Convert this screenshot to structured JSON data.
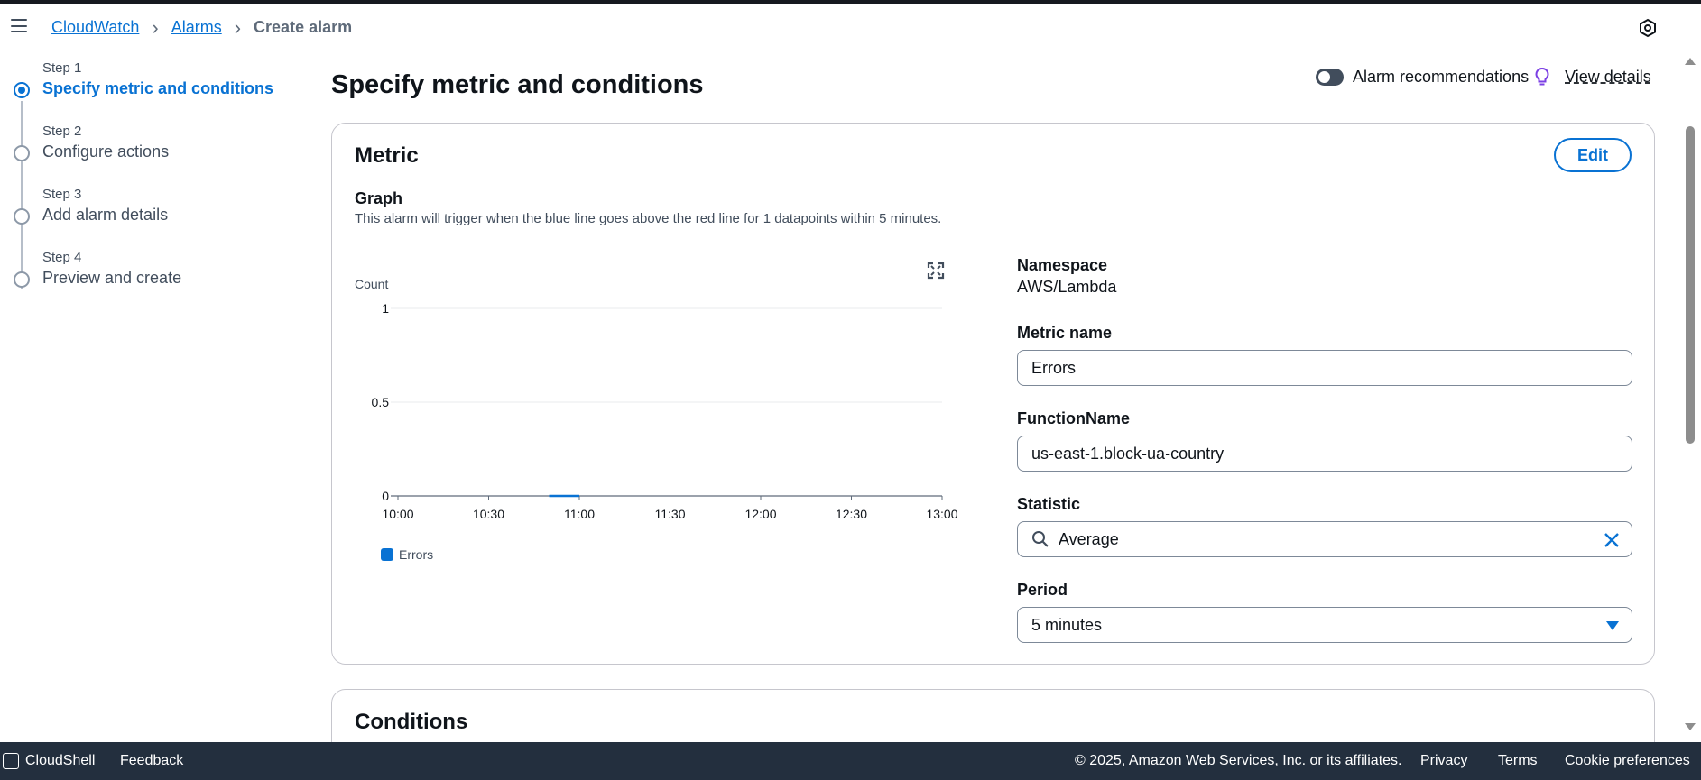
{
  "breadcrumb": {
    "items": [
      "CloudWatch",
      "Alarms"
    ],
    "current": "Create alarm"
  },
  "steps": [
    {
      "num": "Step 1",
      "label": "Specify metric and conditions",
      "active": true
    },
    {
      "num": "Step 2",
      "label": "Configure actions",
      "active": false
    },
    {
      "num": "Step 3",
      "label": "Add alarm details",
      "active": false
    },
    {
      "num": "Step 4",
      "label": "Preview and create",
      "active": false
    }
  ],
  "page": {
    "title": "Specify metric and conditions",
    "recommendations_label": "Alarm recommendations",
    "view_details": "View details"
  },
  "metric_card": {
    "title": "Metric",
    "edit_label": "Edit",
    "graph_heading": "Graph",
    "graph_description": "This alarm will trigger when the blue line goes above the red line for 1 datapoints within 5 minutes."
  },
  "fields": {
    "namespace_label": "Namespace",
    "namespace_value": "AWS/Lambda",
    "metric_name_label": "Metric name",
    "metric_name_value": "Errors",
    "function_name_label": "FunctionName",
    "function_name_value": "us-east-1.block-ua-country",
    "statistic_label": "Statistic",
    "statistic_value": "Average",
    "period_label": "Period",
    "period_value": "5 minutes"
  },
  "conditions_card": {
    "title": "Conditions"
  },
  "footer": {
    "cloudshell": "CloudShell",
    "feedback": "Feedback",
    "copyright": "© 2025, Amazon Web Services, Inc. or its affiliates.",
    "privacy": "Privacy",
    "terms": "Terms",
    "cookie": "Cookie preferences"
  },
  "colors": {
    "accent": "#0972d3",
    "series": "#0972d3",
    "footer_bg": "#232f3e"
  },
  "chart_data": {
    "type": "line",
    "ylabel": "Count",
    "yticks": [
      "1",
      "0.5",
      "0"
    ],
    "ylim": [
      0,
      1
    ],
    "xticks": [
      "10:00",
      "10:30",
      "11:00",
      "11:30",
      "12:00",
      "12:30",
      "13:00"
    ],
    "series": [
      {
        "name": "Errors",
        "color": "#0972d3",
        "x": [
          "10:50",
          "11:00"
        ],
        "values": [
          0,
          0
        ]
      }
    ],
    "grid": true,
    "legend_position": "bottom-left"
  }
}
